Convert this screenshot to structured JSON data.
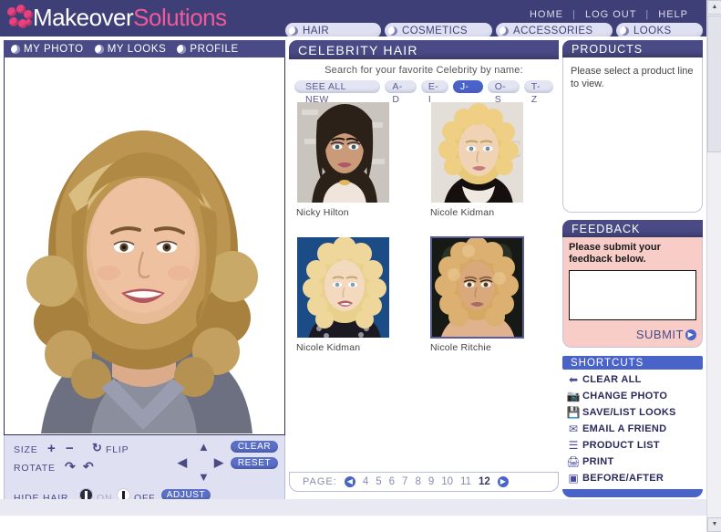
{
  "brand": {
    "part1": "Makeover",
    "part2": "Solutions",
    "logo_icon": "flower-logo"
  },
  "toplinks": {
    "home": "HOME",
    "logout": "LOG OUT",
    "help": "HELP",
    "sep": "|"
  },
  "navtabs": [
    {
      "label": "HAIR"
    },
    {
      "label": "COSMETICS"
    },
    {
      "label": "ACCESSORIES"
    },
    {
      "label": "LOOKS"
    }
  ],
  "left": {
    "tabs": [
      {
        "label": "MY PHOTO"
      },
      {
        "label": "MY LOOKS"
      },
      {
        "label": "PROFILE"
      }
    ],
    "controls": {
      "size_label": "SIZE",
      "plus": "+",
      "minus": "−",
      "flip_label": "FLIP",
      "rotate_label": "ROTATE",
      "clear": "CLEAR",
      "reset": "RESET",
      "hide_hair_label": "HIDE HAIR",
      "on": "ON",
      "off": "OFF",
      "adjust": "ADJUST"
    }
  },
  "middle": {
    "title": "CELEBRITY HAIR",
    "search_prompt": "Search for your favorite Celebrity by name:",
    "filters": [
      {
        "label": "SEE ALL NEW",
        "active": false,
        "wide": true
      },
      {
        "label": "A-D",
        "active": false
      },
      {
        "label": "E-I",
        "active": false
      },
      {
        "label": "J-N",
        "active": true
      },
      {
        "label": "O-S",
        "active": false
      },
      {
        "label": "T-Z",
        "active": false
      }
    ],
    "celebrities": [
      {
        "name": "Nicky Hilton",
        "selected": false
      },
      {
        "name": "Nicole Kidman",
        "selected": false
      },
      {
        "name": "Nicole Kidman",
        "selected": false
      },
      {
        "name": "Nicole Ritchie",
        "selected": true
      }
    ],
    "pagination": {
      "label": "PAGE:",
      "prev_icon": "chevron-left-icon",
      "next_icon": "chevron-right-icon",
      "pages": [
        "4",
        "5",
        "6",
        "7",
        "8",
        "9",
        "10",
        "11",
        "12"
      ],
      "current": "12"
    }
  },
  "right": {
    "products": {
      "title": "PRODUCTS",
      "body": "Please select a product line to view."
    },
    "feedback": {
      "title": "FEEDBACK",
      "prompt": "Please submit your feedback below.",
      "textarea_value": "",
      "submit": "SUBMIT",
      "submit_icon": "arrow-right-circle-icon"
    },
    "shortcuts": {
      "title": "SHORTCUTS",
      "items": [
        {
          "label": "CLEAR ALL",
          "icon": "back-arrow-icon"
        },
        {
          "label": "CHANGE PHOTO",
          "icon": "camera-icon"
        },
        {
          "label": "SAVE/LIST LOOKS",
          "icon": "floppy-disk-icon"
        },
        {
          "label": "EMAIL A FRIEND",
          "icon": "envelope-icon"
        },
        {
          "label": "PRODUCT LIST",
          "icon": "list-icon"
        },
        {
          "label": "PRINT",
          "icon": "printer-icon"
        },
        {
          "label": "BEFORE/AFTER",
          "icon": "compare-icon"
        }
      ]
    }
  },
  "colors": {
    "header_purple": "#3f3f78",
    "panel_header": "#4a4a86",
    "accent_blue": "#4a63c8",
    "brand_pink": "#f05a9b",
    "feedback_pink": "#f8cdc8",
    "tab_light": "#dfe1f2"
  }
}
